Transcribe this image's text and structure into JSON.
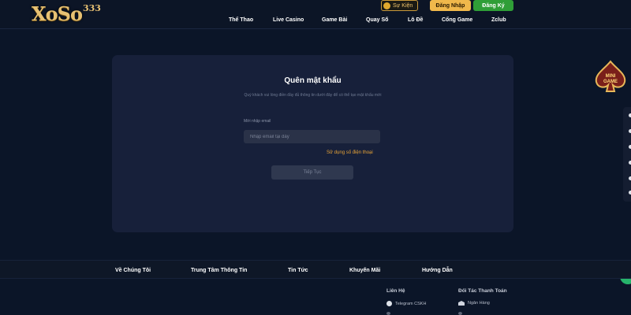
{
  "header": {
    "logo_text": "XoSo",
    "logo_number": "333",
    "event_label": "Sự Kiện",
    "login_label": "Đăng Nhập",
    "register_label": "Đăng Ký"
  },
  "nav": {
    "items": [
      "Thể Thao",
      "Live Casino",
      "Game Bài",
      "Quay Số",
      "Lô Đề",
      "Cổng Game",
      "Zclub"
    ]
  },
  "form": {
    "title": "Quên mật khẩu",
    "subtitle": "Quý khách vui lòng điền đầy đủ thông tin dưới đây để có thể tạo mật khẩu mới",
    "email_label": "Mời nhập email",
    "email_placeholder": "Nhập email tại đây",
    "phone_link": "Sử dụng số điện thoại",
    "continue_label": "Tiếp Tục"
  },
  "badge": {
    "text_line1": "MINI",
    "text_line2": "GAME"
  },
  "footer": {
    "links": [
      "Về Chúng Tôi",
      "Trung Tâm Thông Tin",
      "Tin Tức",
      "Khuyến Mãi",
      "Hướng Dẫn"
    ],
    "contact_heading": "Liên Hệ",
    "contact_item": "Telegram CSKH",
    "payment_heading": "Đối Tác Thanh Toán",
    "payment_item": "Ngân Hàng"
  },
  "colors": {
    "background": "#0b1528",
    "card": "#17203a",
    "accent_gold": "#f0b84b",
    "accent_green": "#2f9e37",
    "link_orange": "#e8a437"
  },
  "icons": {
    "event": "gift-icon",
    "contact": "telegram-icon",
    "payment": "bank-icon",
    "chat": "chat-icon"
  }
}
